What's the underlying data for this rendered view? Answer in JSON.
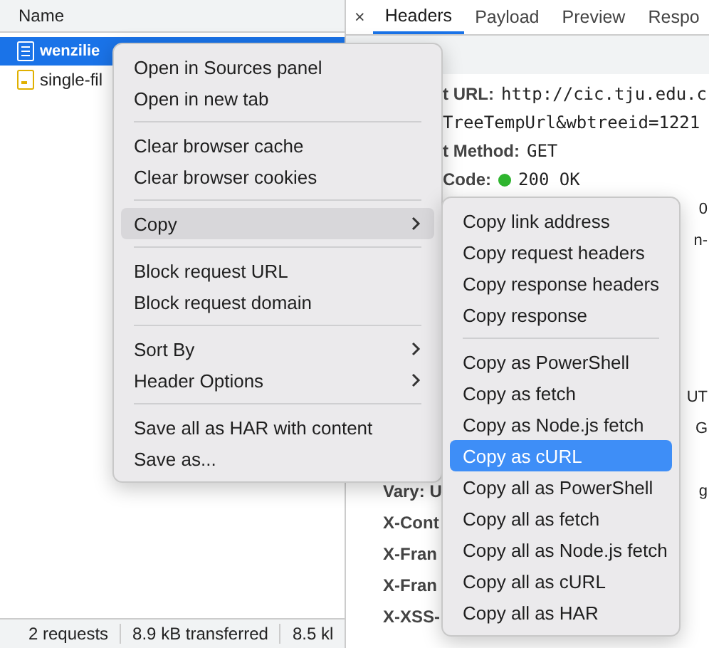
{
  "request_list": {
    "column": "Name",
    "rows": [
      {
        "name": "wenzilie",
        "kind": "document",
        "selected": true
      },
      {
        "name": "single-fil",
        "kind": "script",
        "selected": false
      }
    ]
  },
  "status_bar": [
    "2 requests",
    "8.9 kB transferred",
    "8.5 kl"
  ],
  "detail_tabs": {
    "close": "×",
    "tabs": [
      {
        "label": "Headers",
        "selected": true
      },
      {
        "label": "Payload",
        "selected": false
      },
      {
        "label": "Preview",
        "selected": false
      },
      {
        "label": "Respo",
        "selected": false
      }
    ]
  },
  "general_rows": [
    {
      "name": "t URL:",
      "value": "http://cic.tju.edu.c"
    },
    {
      "name": "",
      "value": "TreeTempUrl&wbtreeid=1221"
    },
    {
      "name": "t Method:",
      "value": "GET"
    },
    {
      "name": "Code:",
      "value": "200 OK",
      "kind": "status"
    }
  ],
  "header_rows": [
    {
      "name": "",
      "tail": "0"
    },
    {
      "name": "",
      "tail": "n-"
    },
    {
      "name": "",
      "tail": ""
    },
    {
      "name": "",
      "tail": ""
    },
    {
      "name": "",
      "tail": ""
    },
    {
      "name": "",
      "tail": ""
    },
    {
      "name": "",
      "tail": "UT"
    },
    {
      "name": "",
      "tail": "G"
    },
    {
      "name": "",
      "tail": ""
    },
    {
      "name": "Vary: U",
      "tail": "g"
    },
    {
      "name": "X-Cont",
      "tail": ""
    },
    {
      "name": "X-Fran",
      "tail": ""
    },
    {
      "name": "X-Fran",
      "tail": ""
    },
    {
      "name": "X-XSS-",
      "tail": ""
    }
  ],
  "context_menu": {
    "groups": [
      [
        {
          "label": "Open in Sources panel",
          "submenu": false,
          "selected": false
        },
        {
          "label": "Open in new tab",
          "submenu": false,
          "selected": false
        }
      ],
      [
        {
          "label": "Clear browser cache",
          "submenu": false,
          "selected": false
        },
        {
          "label": "Clear browser cookies",
          "submenu": false,
          "selected": false
        }
      ],
      [
        {
          "label": "Copy",
          "submenu": true,
          "selected": true
        }
      ],
      [
        {
          "label": "Block request URL",
          "submenu": false,
          "selected": false
        },
        {
          "label": "Block request domain",
          "submenu": false,
          "selected": false
        }
      ],
      [
        {
          "label": "Sort By",
          "submenu": true,
          "selected": false
        },
        {
          "label": "Header Options",
          "submenu": true,
          "selected": false
        }
      ],
      [
        {
          "label": "Save all as HAR with content",
          "submenu": false,
          "selected": false
        },
        {
          "label": "Save as...",
          "submenu": false,
          "selected": false
        }
      ]
    ]
  },
  "copy_submenu": {
    "groups": [
      [
        {
          "label": "Copy link address",
          "selected": false
        },
        {
          "label": "Copy request headers",
          "selected": false
        },
        {
          "label": "Copy response headers",
          "selected": false
        },
        {
          "label": "Copy response",
          "selected": false
        }
      ],
      [
        {
          "label": "Copy as PowerShell",
          "selected": false
        },
        {
          "label": "Copy as fetch",
          "selected": false
        },
        {
          "label": "Copy as Node.js fetch",
          "selected": false
        },
        {
          "label": "Copy as cURL",
          "selected": true
        },
        {
          "label": "Copy all as PowerShell",
          "selected": false
        },
        {
          "label": "Copy all as fetch",
          "selected": false
        },
        {
          "label": "Copy all as Node.js fetch",
          "selected": false
        },
        {
          "label": "Copy all as cURL",
          "selected": false
        },
        {
          "label": "Copy all as HAR",
          "selected": false
        }
      ]
    ]
  }
}
